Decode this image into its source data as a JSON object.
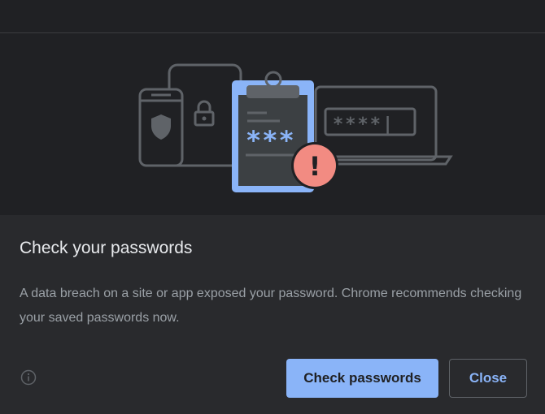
{
  "dialog": {
    "title": "Check your passwords",
    "body": "A data breach on a site or app exposed your password. Chrome recommends checking your saved passwords now.",
    "primary_button_label": "Check passwords",
    "secondary_button_label": "Close"
  },
  "illustration": {
    "masked_password_short": "***",
    "masked_password_long": "****|",
    "alert_glyph": "!"
  },
  "colors": {
    "accent": "#8ab4f8",
    "alert": "#f28b82",
    "background": "#292a2d",
    "illustration_background": "#202124"
  }
}
